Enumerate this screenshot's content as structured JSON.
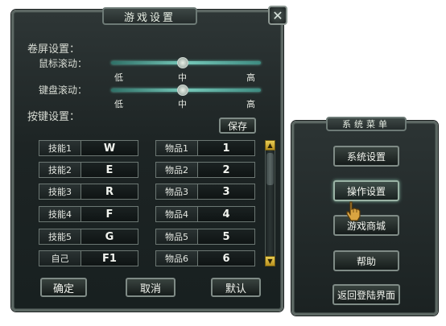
{
  "window": {
    "title": "游戏设置",
    "close_icon": "close-x-icon"
  },
  "scroll_section": {
    "title": "卷屏设置：",
    "mouse_label": "鼠标滚动：",
    "keyboard_label": "键盘滚动：",
    "ticks": [
      "低",
      "中",
      "高"
    ],
    "mouse_level": 0.5,
    "keyboard_level": 0.5
  },
  "key_section": {
    "title": "按键设置：",
    "save_label": "保存",
    "left": [
      {
        "name": "技能1",
        "key": "W"
      },
      {
        "name": "技能2",
        "key": "E"
      },
      {
        "name": "技能3",
        "key": "R"
      },
      {
        "name": "技能4",
        "key": "F"
      },
      {
        "name": "技能5",
        "key": "G"
      },
      {
        "name": "自己",
        "key": "F1"
      }
    ],
    "right": [
      {
        "name": "物品1",
        "key": "1"
      },
      {
        "name": "物品2",
        "key": "2"
      },
      {
        "name": "物品3",
        "key": "3"
      },
      {
        "name": "物品4",
        "key": "4"
      },
      {
        "name": "物品5",
        "key": "5"
      },
      {
        "name": "物品6",
        "key": "6"
      }
    ]
  },
  "footer": {
    "confirm_label": "确定",
    "cancel_label": "取消",
    "default_label": "默认"
  },
  "system_menu": {
    "title": "系统菜单",
    "items": [
      "系统设置",
      "操作设置",
      "游戏商城",
      "帮助",
      "返回登陆界面"
    ],
    "active_index": 1
  },
  "colors": {
    "accent_teal": "#76c7b8",
    "scroll_arrow_gold": "#e9cd55",
    "panel_dark": "#1d2424"
  }
}
